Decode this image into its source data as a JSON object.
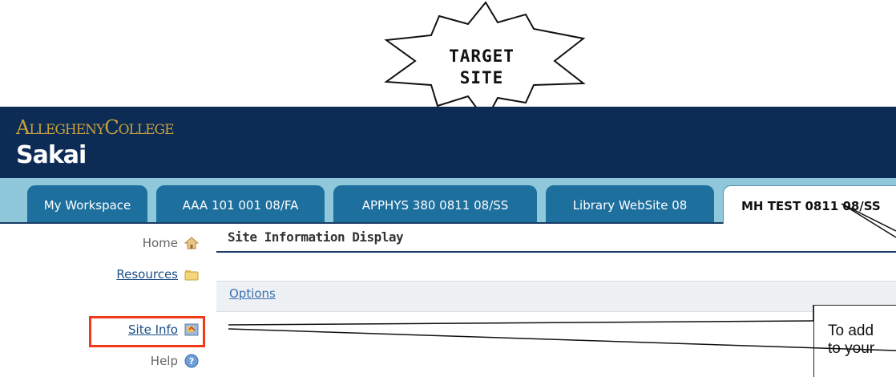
{
  "callout": {
    "line1": "TARGET",
    "line2": "SITE"
  },
  "branding": {
    "college_first": "A",
    "college_rest1": "LLEGHENY",
    "college_c": "C",
    "college_rest2": "OLLEGE",
    "app": "Sakai"
  },
  "tabs": [
    {
      "label": "My Workspace",
      "active": false
    },
    {
      "label": "AAA 101 001 08/FA",
      "active": false
    },
    {
      "label": "APPHYS 380 0811 08/SS",
      "active": false
    },
    {
      "label": "Library WebSite 08",
      "active": false
    },
    {
      "label": "MH TEST 0811 08/SS",
      "active": true
    }
  ],
  "nav": [
    {
      "label": "Home",
      "icon": "home-icon",
      "link": false
    },
    {
      "label": "Resources",
      "icon": "folder-icon",
      "link": true
    },
    {
      "label": "Site Info",
      "icon": "site-info-icon",
      "link": true
    },
    {
      "label": "Help",
      "icon": "help-icon",
      "link": false
    }
  ],
  "panel": {
    "title": "Site Information Display",
    "options": "Options"
  },
  "note": {
    "line1": "To add",
    "line2": "to your"
  },
  "colors": {
    "header": "#0c2c55",
    "tabbar": "#8fc8da",
    "tab": "#1d6f9e",
    "gold": "#c9a13b",
    "highlight": "#f03a18"
  }
}
